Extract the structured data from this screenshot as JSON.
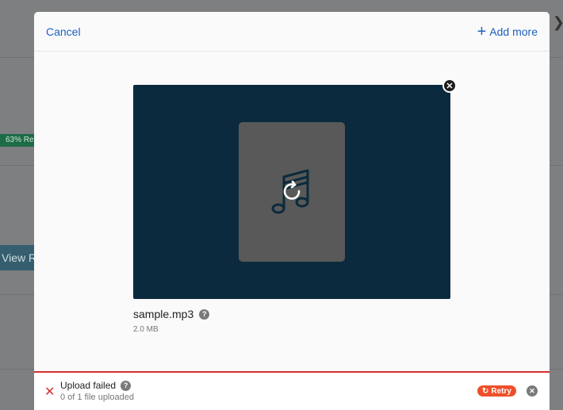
{
  "background": {
    "progress_pill": "63% Re",
    "view_button": "View R"
  },
  "header": {
    "cancel_label": "Cancel",
    "add_more_label": "Add more"
  },
  "file": {
    "name": "sample.mp3",
    "size": "2.0 MB",
    "help_glyph": "?",
    "icon": "music-note-icon"
  },
  "status": {
    "title": "Upload failed",
    "subtitle": "0 of 1 file uploaded",
    "help_glyph": "?",
    "retry_label": "Retry"
  },
  "colors": {
    "accent": "#1f5fbf",
    "preview_bg": "#0c2a3d",
    "error": "#d32f2f",
    "retry": "#ef4f2a"
  }
}
